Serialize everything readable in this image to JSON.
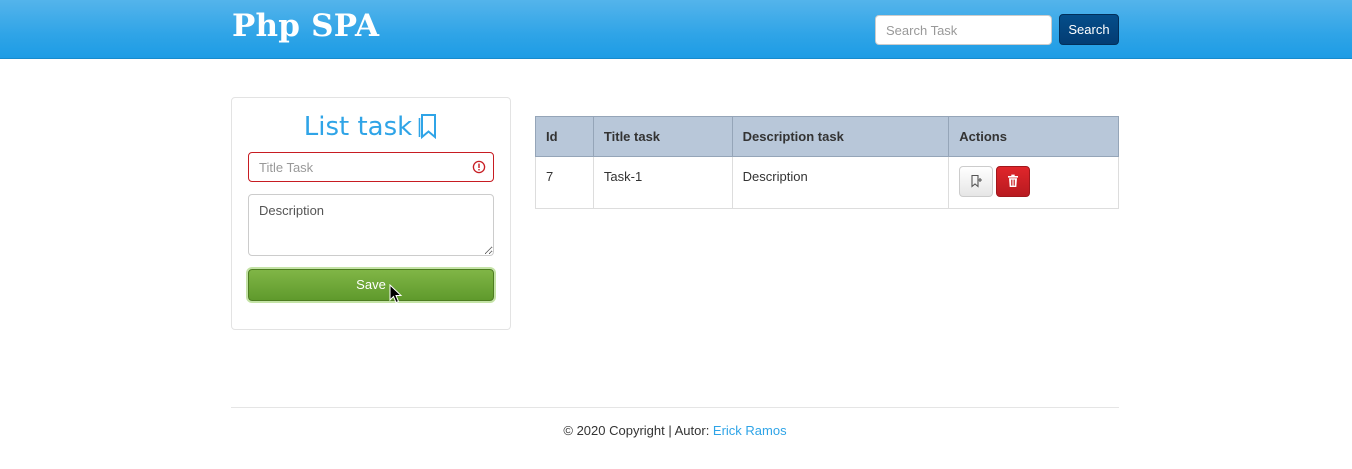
{
  "navbar": {
    "brand": "Php SPA",
    "search_placeholder": "Search Task",
    "search_button": "Search"
  },
  "form": {
    "title": "List task",
    "title_placeholder": "Title Task",
    "description_placeholder": "Description",
    "save_button": "Save"
  },
  "table": {
    "headers": [
      "Id",
      "Title task",
      "Description task",
      "Actions"
    ],
    "rows": [
      {
        "id": "7",
        "title": "Task-1",
        "description": "Description"
      }
    ]
  },
  "footer": {
    "text": "© 2020 Copyright | Autor: ",
    "author": "Erick Ramos"
  },
  "colors": {
    "primary": "#2fa4e7",
    "navy_button": "#033c73",
    "success": "#73a839",
    "danger": "#c71c22",
    "table_header": "#b8c7d9"
  }
}
